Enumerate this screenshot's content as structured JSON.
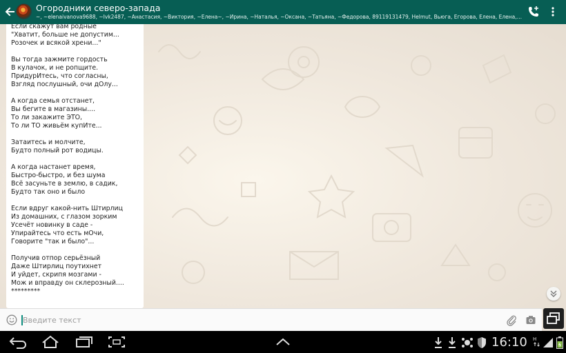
{
  "header": {
    "title": "Огородники северо-запада",
    "participants": "~, ~elenaivanova9688, ~Ivk2487, ~Анастасия, ~Виктория, ~Елена~, ~Ирина, ~Наталья, ~Оксана, ~Татьяна, ~Федорова, 89119131479, Helmut, Вьюга, Егорова, Елена, Елена, Ирина, Ири..."
  },
  "message": {
    "stanzas": [
      "Если скажут вам родные\n\"Хватит, больше не допустим...\nРозочек и всякой хрени...\"",
      "Вы тогда зажмите гордость\nВ кулачок, и не ропщите.\nПридурИтесь, что согласны,\nВзгляд послушный, очи дОлу...",
      "А когда семья отстанет,\nВы бегите в магазины....\nТо ли закажите ЭТО,\nТо ли ТО живьём купИте...",
      "Затаитесь и молчите,\nБудто полный рот водицы.",
      "А когда настанет время,\nБыстро-быстро, и без шума\nВсё засуньте в землю, в садик,\nБудто так оно и было",
      "Если вдруг какой-нить Штирлиц\nИз домашних, с глазом зорким\nУсечёт новинку в саде -\nУпирайтесь что есть мОчи,\nГоворите \"так и было\"...",
      "Получив отпор серьёзный\nДаже Штирлиц поутихнет\nИ уйдет, скрипя мозгами -\nМож и вправду он склерозный....\n*********"
    ]
  },
  "input": {
    "placeholder": "Введите текст",
    "value": ""
  },
  "status": {
    "time": "16:10"
  },
  "icons": {
    "back": "back-arrow-icon",
    "call": "add-call-icon",
    "menu": "more-vert-icon",
    "emoji": "emoji-icon",
    "attach": "paperclip-icon",
    "camera": "camera-icon"
  },
  "colors": {
    "header": "#075e54",
    "accent": "#0b8b7c",
    "chat_background": "#efe7dc",
    "bubble": "#ffffff"
  }
}
